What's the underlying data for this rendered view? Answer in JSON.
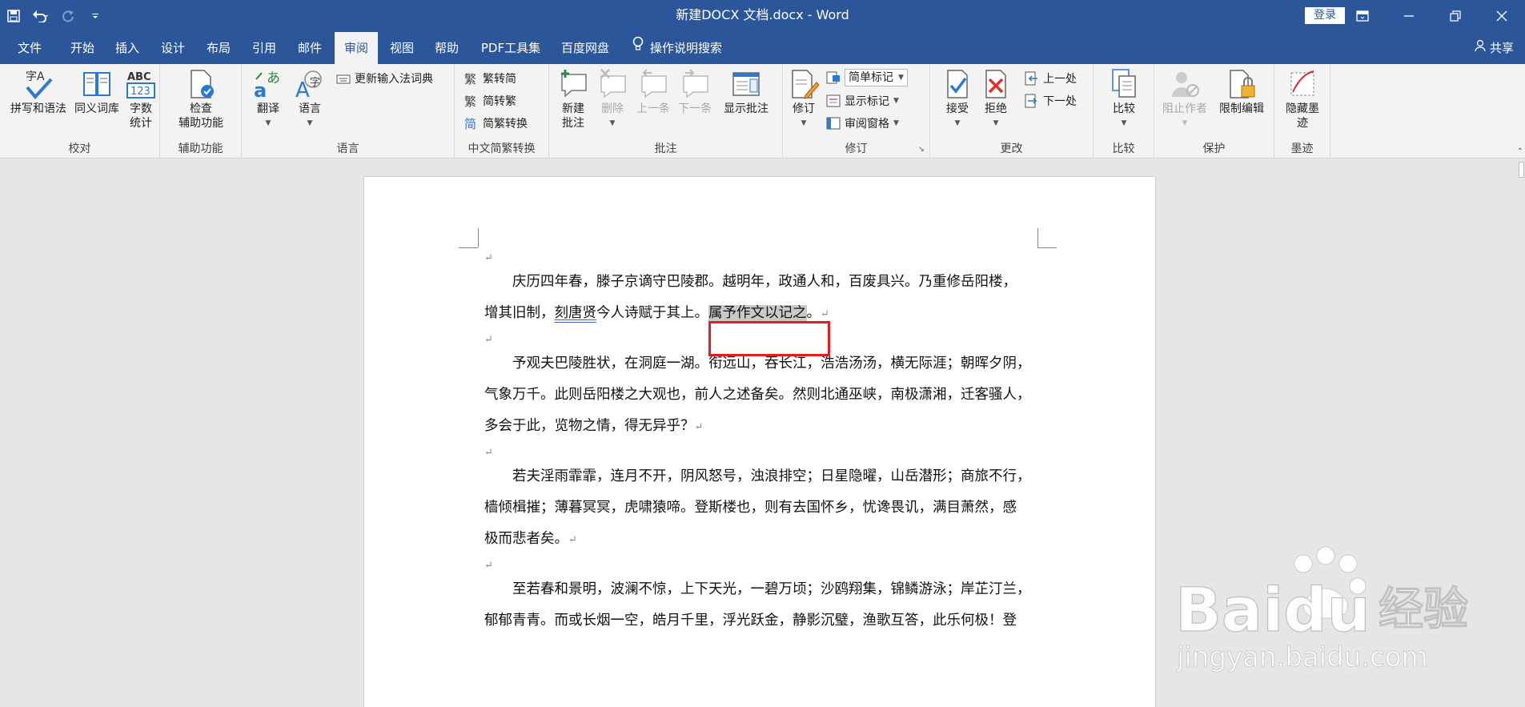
{
  "titlebar": {
    "title": "新建DOCX 文档.docx  -  Word",
    "login": "登录",
    "qat": [
      "save-icon",
      "undo-icon",
      "redo-icon",
      "customize-qat-icon"
    ]
  },
  "tabs": [
    "文件",
    "开始",
    "插入",
    "设计",
    "布局",
    "引用",
    "邮件",
    "审阅",
    "视图",
    "帮助",
    "PDF工具集",
    "百度网盘"
  ],
  "active_tab": "审阅",
  "tellme": "操作说明搜索",
  "share": "共享",
  "ribbon": {
    "proofing": {
      "label": "校对",
      "spelling": "拼写和语法",
      "thesaurus": "同义词库",
      "wordcount": "字数\n统计"
    },
    "accessibility": {
      "label": "辅助功能",
      "check": "检查\n辅助功能"
    },
    "language": {
      "label": "语言",
      "translate": "翻译",
      "language": "语言",
      "update_ime": "更新输入法词典"
    },
    "chinese": {
      "label": "中文简繁转换",
      "t2s": "繁转简",
      "s2t": "简转繁",
      "convert": "简繁转换"
    },
    "comments": {
      "label": "批注",
      "new": "新建\n批注",
      "delete": "删除",
      "prev": "上一条",
      "next": "下一条",
      "show": "显示批注"
    },
    "tracking": {
      "label": "修订",
      "track": "修订",
      "markup_select": "简单标记",
      "show_markup": "显示标记",
      "review_pane": "审阅窗格"
    },
    "changes": {
      "label": "更改",
      "accept": "接受",
      "reject": "拒绝",
      "prev": "上一处",
      "next": "下一处"
    },
    "compare": {
      "label": "比较",
      "compare": "比较"
    },
    "protect": {
      "label": "保护",
      "block": "阻止作者",
      "restrict": "限制编辑"
    },
    "ink": {
      "label": "墨迹",
      "hide": "隐藏墨\n迹"
    }
  },
  "document": {
    "paragraphs": [
      [
        "　　庆历四年春，滕子京谪守巴陵郡。越明年，政通人和，百废具兴。乃重修岳阳楼，",
        "增其旧制，刻唐贤今人诗赋于其上。",
        "属予作文以记之",
        "。"
      ],
      [
        "　　予观夫巴陵胜状，在洞庭一湖。衔远山，吞长江，浩浩汤汤，横无际涯；朝晖夕阴，",
        "气象万千。此则岳阳楼之大观也，前人之述备矣。然则北通巫峡，南极潇湘，迁客骚人，",
        "多会于此，览物之情，得无异乎？"
      ],
      [
        "　　若夫淫雨霏霏，连月不开，阴风怒号，浊浪排空；日星隐曜，山岳潜形；商旅不行，",
        "樯倾楫摧；薄暮冥冥，虎啸猿啼。登斯楼也，则有去国怀乡，忧谗畏讥，满目萧然，感",
        "极而悲者矣。"
      ],
      [
        "　　至若春和景明，波澜不惊，上下天光，一碧万顷；沙鸥翔集，锦鳞游泳；岸芷汀兰，",
        "郁郁青青。而或长烟一空，皓月千里，浮光跃金，静影沉璧，渔歌互答，此乐何极！登"
      ]
    ],
    "return_mark": "↵"
  },
  "watermark": {
    "brand": "Baidu",
    "suffix": "经验",
    "url": "jingyan.baidu.com"
  }
}
